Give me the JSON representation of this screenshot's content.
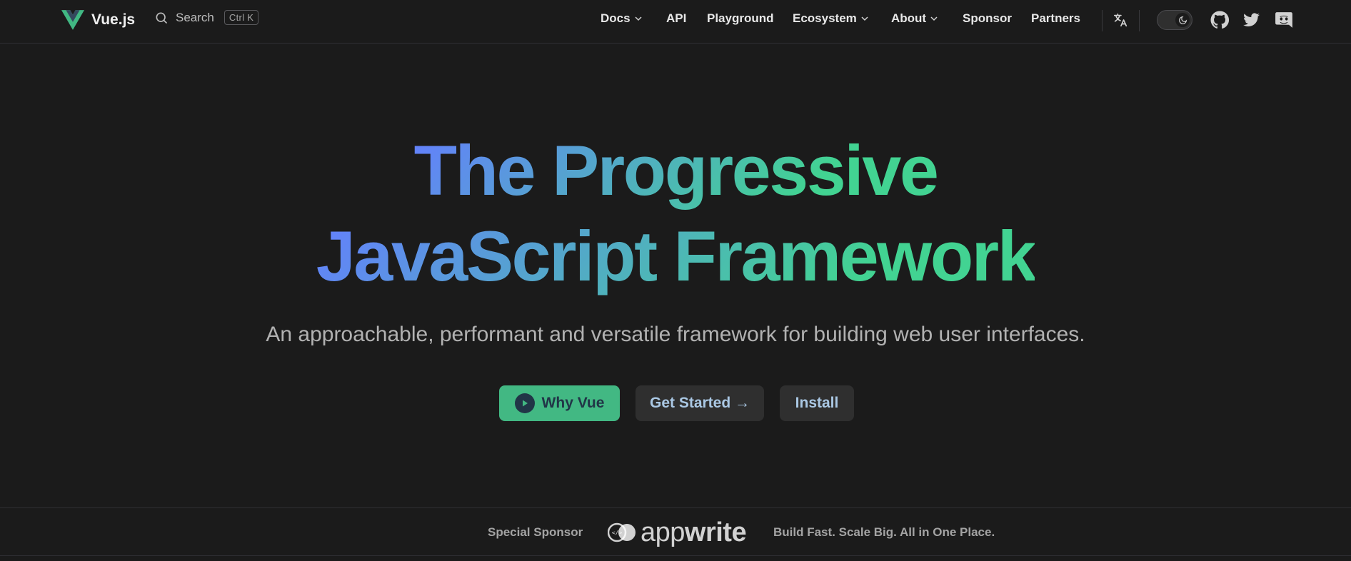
{
  "nav": {
    "brand": "Vue.js",
    "search_label": "Search",
    "search_kbd": "Ctrl K",
    "items": [
      {
        "label": "Docs",
        "dropdown": true
      },
      {
        "label": "API",
        "dropdown": false
      },
      {
        "label": "Playground",
        "dropdown": false
      },
      {
        "label": "Ecosystem",
        "dropdown": true
      },
      {
        "label": "About",
        "dropdown": true
      },
      {
        "label": "Sponsor",
        "dropdown": false
      },
      {
        "label": "Partners",
        "dropdown": false
      }
    ],
    "icons": [
      "translate-icon",
      "theme-toggle",
      "github-icon",
      "twitter-icon",
      "discord-icon"
    ]
  },
  "hero": {
    "title_line1": "The Progressive",
    "title_line2": "JavaScript Framework",
    "tagline": "An approachable, performant and versatile framework for building web user interfaces.",
    "primary_button": "Why Vue",
    "get_started_button": "Get Started →",
    "install_button": "Install"
  },
  "sponsor": {
    "label": "Special Sponsor",
    "logo_text_light": "app",
    "logo_text_bold": "write",
    "tagline": "Build Fast. Scale Big. All in One Place."
  },
  "colors": {
    "background": "#1b1b1b",
    "brand_green": "#42b883",
    "gradient_start": "#42d392",
    "gradient_end": "#647eff",
    "secondary_button_text": "#aac8e4"
  }
}
